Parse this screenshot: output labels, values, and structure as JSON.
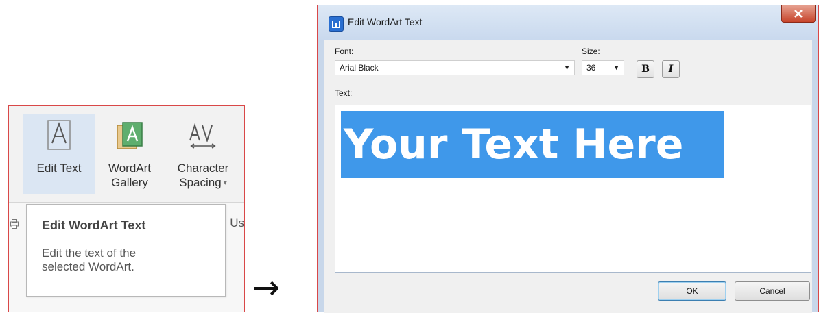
{
  "ribbon": {
    "buttons": [
      {
        "icon": "edit-text-icon",
        "label": "Edit Text",
        "active": true
      },
      {
        "icon": "wordart-gallery-icon",
        "label_line1": "WordArt",
        "label_line2": "Gallery"
      },
      {
        "icon": "character-spacing-icon",
        "label_line1": "Character",
        "label_line2": "Spacing",
        "dropdown_arrow": "▾"
      }
    ],
    "partial_text": "Us"
  },
  "tooltip": {
    "title": "Edit WordArt Text",
    "body_line1": "Edit the text of the",
    "body_line2": "selected WordArt."
  },
  "arrow": "→",
  "dialog": {
    "title": "Edit WordArt Text",
    "font_label": "Font:",
    "font_value": "Arial Black",
    "size_label": "Size:",
    "size_value": "36",
    "bold_label": "B",
    "italic_label": "I",
    "text_label": "Text:",
    "text_value": "Your Text Here",
    "ok_label": "OK",
    "cancel_label": "Cancel"
  },
  "colors": {
    "selection": "#3f98ea",
    "close_button": "#c7442b",
    "app_icon": "#2a6fd1"
  }
}
